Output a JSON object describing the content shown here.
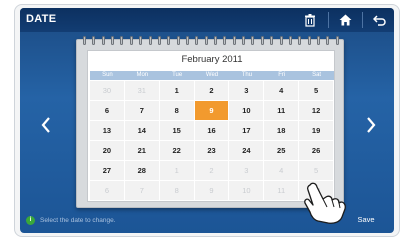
{
  "header": {
    "title": "DATE",
    "icons": [
      "trash-icon",
      "home-icon",
      "back-icon"
    ]
  },
  "calendar": {
    "month_label": "February 2011",
    "weekdays": [
      "Sun",
      "Mon",
      "Tue",
      "Wed",
      "Thu",
      "Fri",
      "Sat"
    ],
    "selected_day": "9",
    "weeks": [
      [
        {
          "d": "30",
          "m": true
        },
        {
          "d": "31",
          "m": true
        },
        {
          "d": "1"
        },
        {
          "d": "2"
        },
        {
          "d": "3"
        },
        {
          "d": "4"
        },
        {
          "d": "5"
        }
      ],
      [
        {
          "d": "6"
        },
        {
          "d": "7"
        },
        {
          "d": "8"
        },
        {
          "d": "9",
          "sel": true
        },
        {
          "d": "10"
        },
        {
          "d": "11"
        },
        {
          "d": "12"
        }
      ],
      [
        {
          "d": "13"
        },
        {
          "d": "14"
        },
        {
          "d": "15"
        },
        {
          "d": "16"
        },
        {
          "d": "17"
        },
        {
          "d": "18"
        },
        {
          "d": "19"
        }
      ],
      [
        {
          "d": "20"
        },
        {
          "d": "21"
        },
        {
          "d": "22"
        },
        {
          "d": "23"
        },
        {
          "d": "24"
        },
        {
          "d": "25"
        },
        {
          "d": "26"
        }
      ],
      [
        {
          "d": "27"
        },
        {
          "d": "28"
        },
        {
          "d": "1",
          "m": true
        },
        {
          "d": "2",
          "m": true
        },
        {
          "d": "3",
          "m": true
        },
        {
          "d": "4",
          "m": true
        },
        {
          "d": "5",
          "m": true
        }
      ],
      [
        {
          "d": "6",
          "m": true
        },
        {
          "d": "7",
          "m": true
        },
        {
          "d": "8",
          "m": true
        },
        {
          "d": "9",
          "m": true
        },
        {
          "d": "10",
          "m": true
        },
        {
          "d": "11",
          "m": true
        },
        {
          "d": "12",
          "m": true
        }
      ]
    ]
  },
  "nav": {
    "prev_icon": "chevron-left-icon",
    "next_icon": "chevron-right-icon"
  },
  "footer": {
    "hint": "Select the date to change.",
    "hint_icon": "info-icon",
    "save_label": "Save"
  },
  "colors": {
    "background": "#2563a6",
    "header": "#0c3060",
    "selected": "#f29a2e",
    "weekday_bar": "#a9c3df"
  }
}
